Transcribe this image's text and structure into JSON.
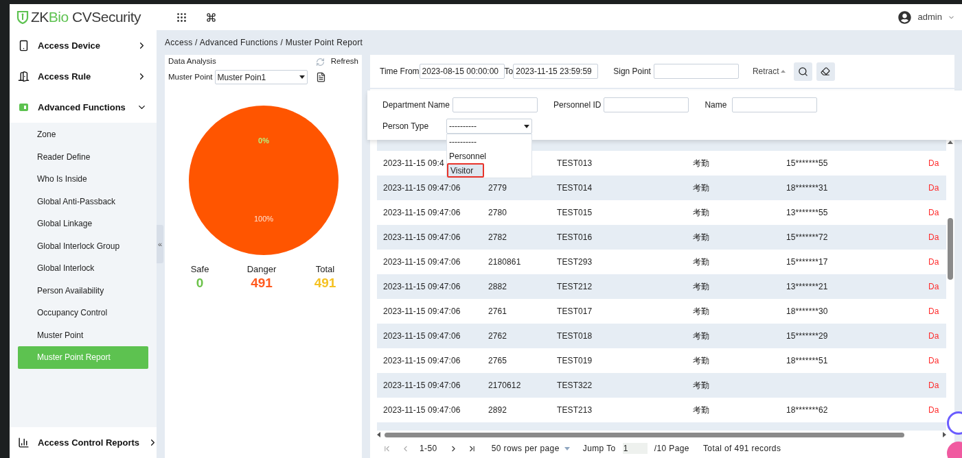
{
  "header": {
    "logo": [
      "ZK",
      "Bio",
      "CVSecurity"
    ],
    "user": "admin"
  },
  "sidebar": {
    "items": [
      {
        "label": "Access Device",
        "expanded": false,
        "kind": "device"
      },
      {
        "label": "Access Rule",
        "expanded": false,
        "kind": "door"
      },
      {
        "label": "Advanced Functions",
        "expanded": true,
        "kind": "advanced",
        "children": [
          {
            "label": "Zone",
            "selected": false
          },
          {
            "label": "Reader Define",
            "selected": false
          },
          {
            "label": "Who Is Inside",
            "selected": false
          },
          {
            "label": "Global Anti-Passback",
            "selected": false
          },
          {
            "label": "Global Linkage",
            "selected": false
          },
          {
            "label": "Global Interlock Group",
            "selected": false
          },
          {
            "label": "Global Interlock",
            "selected": false
          },
          {
            "label": "Person Availability",
            "selected": false
          },
          {
            "label": "Occupancy Control",
            "selected": false
          },
          {
            "label": "Muster Point",
            "selected": false
          },
          {
            "label": "Muster Point Report",
            "selected": true
          }
        ]
      }
    ],
    "bottom_item": {
      "label": "Access Control Reports",
      "expanded": false,
      "kind": "reports"
    },
    "collapse_handle": "«"
  },
  "breadcrumb": "Access / Advanced Functions / Muster Point Report",
  "analysis": {
    "title": "Data Analysis",
    "refresh": "Refresh",
    "muster_point_label": "Muster Point",
    "muster_point_value": "Muster Poin1",
    "chart_data": {
      "type": "pie",
      "values": [
        0,
        100
      ],
      "value_labels": [
        "0%",
        "100%"
      ]
    },
    "stats": [
      {
        "label": "Safe",
        "value": "0",
        "color": "#6cc24a"
      },
      {
        "label": "Danger",
        "value": "491",
        "color": "#ff5a1f"
      },
      {
        "label": "Total",
        "value": "491",
        "color": "#f5c223"
      }
    ]
  },
  "filters": {
    "time_from_label": "Time From",
    "time_from": "2023-08-15 00:00:00",
    "to_label": "To",
    "time_to": "2023-11-15 23:59:59",
    "sign_point_label": "Sign Point",
    "retract": "Retract",
    "department_label": "Department Name",
    "personnel_id_label": "Personnel ID",
    "name_label": "Name",
    "person_type_label": "Person Type",
    "person_type_value": "----------",
    "person_type_options": [
      {
        "label": "----------",
        "selected": false
      },
      {
        "label": "Personnel",
        "selected": false
      },
      {
        "label": "Visitor",
        "selected": true
      }
    ]
  },
  "table": {
    "rows": [
      {
        "time": "2023-11-15 09:4",
        "name": "TEST013",
        "dept": "考勤",
        "phone": "15*******55",
        "status": "Da"
      },
      {
        "time": "2023-11-15 09:47:06",
        "id": "2779",
        "name": "TEST014",
        "dept": "考勤",
        "phone": "18*******31",
        "status": "Da"
      },
      {
        "time": "2023-11-15 09:47:06",
        "id": "2780",
        "name": "TEST015",
        "dept": "考勤",
        "phone": "13*******55",
        "status": "Da"
      },
      {
        "time": "2023-11-15 09:47:06",
        "id": "2782",
        "name": "TEST016",
        "dept": "考勤",
        "phone": "15*******72",
        "status": "Da"
      },
      {
        "time": "2023-11-15 09:47:06",
        "id": "2180861",
        "name": "TEST293",
        "dept": "考勤",
        "phone": "15*******17",
        "status": "Da"
      },
      {
        "time": "2023-11-15 09:47:06",
        "id": "2882",
        "name": "TEST212",
        "dept": "考勤",
        "phone": "13*******21",
        "status": "Da"
      },
      {
        "time": "2023-11-15 09:47:06",
        "id": "2761",
        "name": "TEST017",
        "dept": "考勤",
        "phone": "18*******30",
        "status": "Da"
      },
      {
        "time": "2023-11-15 09:47:06",
        "id": "2762",
        "name": "TEST018",
        "dept": "考勤",
        "phone": "15*******29",
        "status": "Da"
      },
      {
        "time": "2023-11-15 09:47:06",
        "id": "2765",
        "name": "TEST019",
        "dept": "考勤",
        "phone": "18*******51",
        "status": "Da"
      },
      {
        "time": "2023-11-15 09:47:06",
        "id": "2170612",
        "name": "TEST322",
        "dept": "考勤",
        "status": "Da"
      },
      {
        "time": "2023-11-15 09:47:06",
        "id": "2892",
        "name": "TEST213",
        "dept": "考勤",
        "phone": "18*******62",
        "status": "Da"
      }
    ]
  },
  "pagination": {
    "range": "1-50",
    "rows_per_page": "50 rows per page",
    "jump_to": "Jump To",
    "page": "1",
    "pages": "/10 Page",
    "total": "Total of 491 records"
  }
}
